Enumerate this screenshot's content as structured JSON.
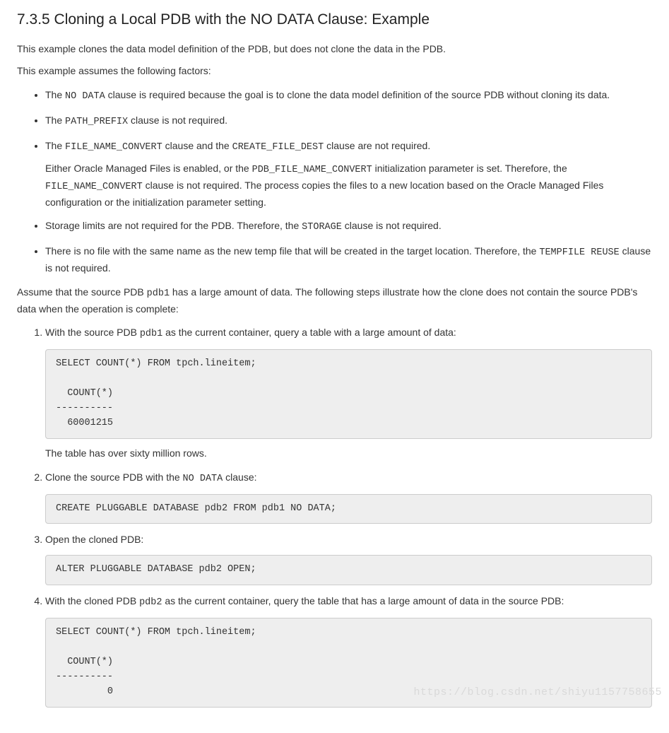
{
  "heading": "7.3.5 Cloning a Local PDB with the NO DATA Clause: Example",
  "intro1": "This example clones the data model definition of the PDB, but does not clone the data in the PDB.",
  "intro2": "This example assumes the following factors:",
  "bullets": {
    "b1_pre": "The ",
    "b1_code": "NO DATA",
    "b1_post": " clause is required because the goal is to clone the data model definition of the source PDB without cloning its data.",
    "b2_pre": "The ",
    "b2_code": "PATH_PREFIX",
    "b2_post": " clause is not required.",
    "b3_pre": "The ",
    "b3_code1": "FILE_NAME_CONVERT",
    "b3_mid": " clause and the ",
    "b3_code2": "CREATE_FILE_DEST",
    "b3_post": " clause are not required.",
    "b3p_pre": "Either Oracle Managed Files is enabled, or the ",
    "b3p_code1": "PDB_FILE_NAME_CONVERT",
    "b3p_mid": " initialization parameter is set. Therefore, the ",
    "b3p_code2": "FILE_NAME_CONVERT",
    "b3p_post": " clause is not required. The process copies the files to a new location based on the Oracle Managed Files configuration or the initialization parameter setting.",
    "b4_pre": "Storage limits are not required for the PDB. Therefore, the ",
    "b4_code": "STORAGE",
    "b4_post": " clause is not required.",
    "b5_pre": "There is no file with the same name as the new temp file that will be created in the target location. Therefore, the ",
    "b5_code": "TEMPFILE REUSE",
    "b5_post": " clause is not required."
  },
  "assume_pre": "Assume that the source PDB ",
  "assume_code": "pdb1",
  "assume_post": " has a large amount of data. The following steps illustrate how the clone does not contain the source PDB's data when the operation is complete:",
  "steps": {
    "s1_pre": "With the source PDB ",
    "s1_code": "pdb1",
    "s1_post": " as the current container, query a table with a large amount of data:",
    "s1_block": "SELECT COUNT(*) FROM tpch.lineitem;\n\n  COUNT(*)\n----------\n  60001215",
    "s1_after": "The table has over sixty million rows.",
    "s2_pre": "Clone the source PDB with the ",
    "s2_code": "NO DATA",
    "s2_post": " clause:",
    "s2_block": "CREATE PLUGGABLE DATABASE pdb2 FROM pdb1 NO DATA;",
    "s3_text": "Open the cloned PDB:",
    "s3_block": "ALTER PLUGGABLE DATABASE pdb2 OPEN;",
    "s4_pre": "With the cloned PDB ",
    "s4_code": "pdb2",
    "s4_post": " as the current container, query the table that has a large amount of data in the source PDB:",
    "s4_block": "SELECT COUNT(*) FROM tpch.lineitem;\n\n  COUNT(*)\n----------\n         0"
  },
  "watermark": "https://blog.csdn.net/shiyu1157758655"
}
